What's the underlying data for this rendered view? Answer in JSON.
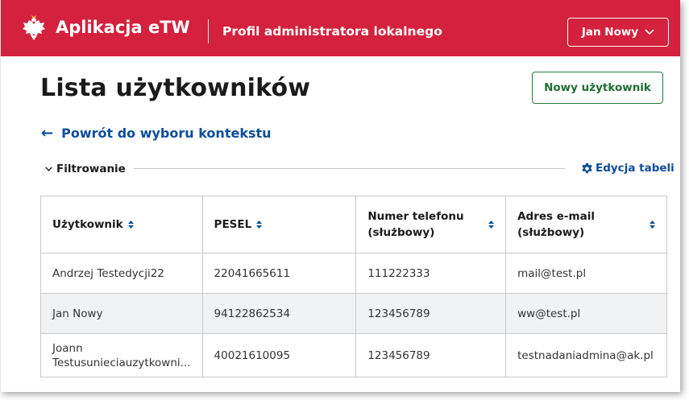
{
  "header": {
    "app_name": "Aplikacja eTW",
    "profile": "Profil administratora lokalnego",
    "user_menu": "Jan Nowy"
  },
  "page": {
    "title": "Lista użytkowników",
    "new_user_button": "Nowy użytkownik",
    "back_link": "Powrót do wyboru kontekstu",
    "filter_label": "Filtrowanie",
    "edit_table": "Edycja tabeli"
  },
  "table": {
    "columns": [
      {
        "line1": "Użytkownik",
        "line2": ""
      },
      {
        "line1": "PESEL",
        "line2": ""
      },
      {
        "line1": "Numer telefonu",
        "line2": "(służbowy)"
      },
      {
        "line1": "Adres e-mail",
        "line2": "(służbowy)"
      }
    ],
    "rows": [
      {
        "user": "Andrzej Testedycji22",
        "user2": "",
        "pesel": "22041665611",
        "phone": "111222333",
        "email": "mail@test.pl"
      },
      {
        "user": "Jan Nowy",
        "user2": "",
        "pesel": "94122862534",
        "phone": "123456789",
        "email": "ww@test.pl"
      },
      {
        "user": "Joann",
        "user2": "Testusunieciauzytkowni...",
        "pesel": "40021610095",
        "phone": "123456789",
        "email": "testnadaniadmina@ak.pl"
      }
    ]
  },
  "colors": {
    "header_bg": "#d4213d",
    "link": "#0d4d9b",
    "primary_green": "#257a3b"
  }
}
